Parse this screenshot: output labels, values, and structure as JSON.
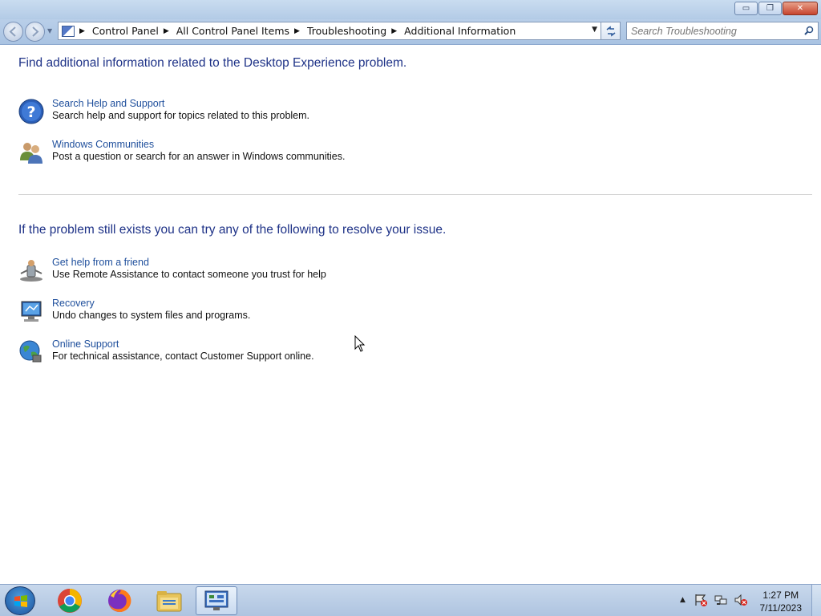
{
  "window": {
    "minimize_glyph": "▭",
    "restore_glyph": "❐",
    "close_glyph": "✕"
  },
  "address_bar": {
    "breadcrumbs": [
      "Control Panel",
      "All Control Panel Items",
      "Troubleshooting",
      "Additional Information"
    ]
  },
  "search": {
    "placeholder": "Search Troubleshooting"
  },
  "section1": {
    "heading": "Find additional information related to the Desktop Experience problem.",
    "items": [
      {
        "title": "Search Help and Support",
        "description": "Search help and support for topics related to this problem.",
        "icon": "help-icon"
      },
      {
        "title": "Windows Communities",
        "description": "Post a question or search for an answer in Windows communities.",
        "icon": "people-icon"
      }
    ]
  },
  "section2": {
    "heading": "If the problem still exists you can try any of the following to resolve your issue.",
    "items": [
      {
        "title": "Get help from a friend",
        "description": "Use Remote Assistance to contact someone you trust for help",
        "icon": "remote-assistance-icon"
      },
      {
        "title": "Recovery",
        "description": "Undo changes to system files and programs.",
        "icon": "recovery-icon"
      },
      {
        "title": "Online Support",
        "description": "For technical assistance, contact Customer Support online.",
        "icon": "globe-icon"
      }
    ]
  },
  "taskbar": {
    "pinned": [
      "chrome-icon",
      "firefox-icon",
      "file-explorer-icon",
      "control-panel-icon"
    ],
    "clock_time": "1:27 PM",
    "clock_date": "7/11/2023"
  },
  "colors": {
    "heading": "#1e3287",
    "link": "#1f4f9c"
  }
}
